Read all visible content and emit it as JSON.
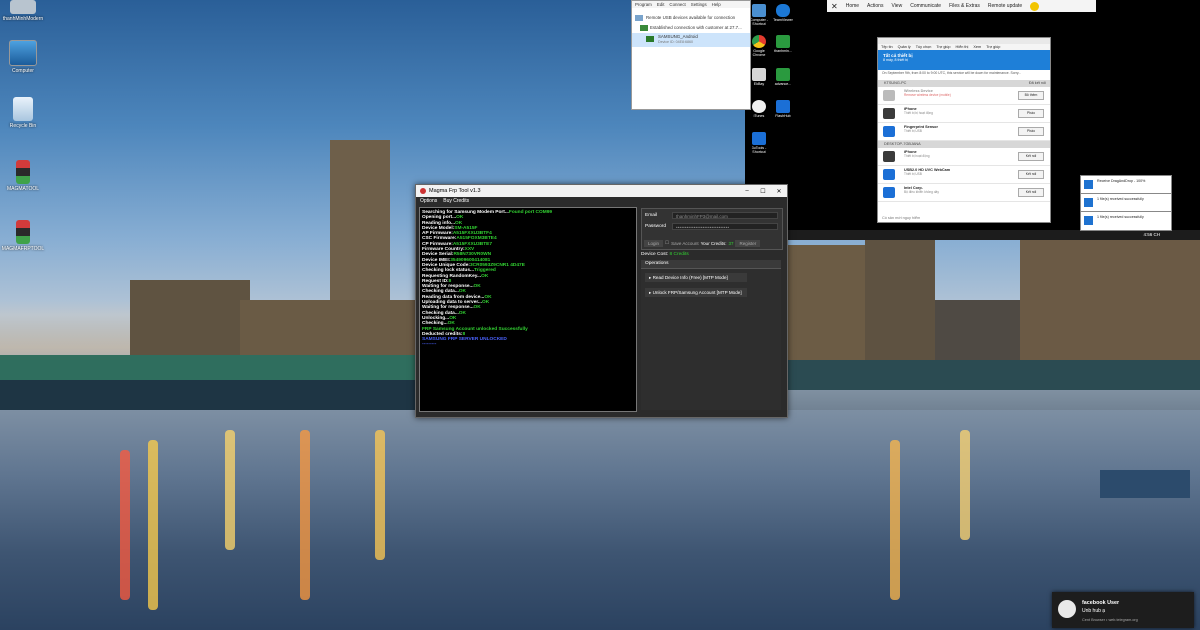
{
  "desktop": {
    "icons": [
      {
        "label": "thanhMinhModern"
      },
      {
        "label": "Computer"
      },
      {
        "label": "Recycle Bin"
      },
      {
        "label": "MAGMATOOL"
      },
      {
        "label": "MAGMAFRPTOOL"
      }
    ]
  },
  "magma": {
    "title": "Magma Frp Tool v1.3",
    "menu": [
      "Options",
      "Buy Credits"
    ],
    "log": [
      {
        "label": "Searching for Samsung Modem Port...",
        "value": "Found port COM99"
      },
      {
        "label": "Opening port...",
        "value": "OK"
      },
      {
        "label": "Reading info...",
        "value": "OK"
      },
      {
        "label": "Device Model:",
        "value": "SM-A515F"
      },
      {
        "label": "AP Firmware:",
        "value": "A515FXXU3BTF4"
      },
      {
        "label": "CSC Firmware:",
        "value": "A515FOXM3BTE4"
      },
      {
        "label": "CP Firmware:",
        "value": "A515FXXU3BTE7"
      },
      {
        "label": "Firmware Country:",
        "value": "XXV"
      },
      {
        "label": "Device Serial:",
        "value": "R58N730VR0WN"
      },
      {
        "label": "Device IMEI:",
        "value": "354909600414081"
      },
      {
        "label": "Device Unique Code:",
        "value": "3CR0593Z9CNR1 4D47E"
      },
      {
        "label": "Checking lock status...",
        "value": "Triggered"
      },
      {
        "label": "Requesting RandomKey...",
        "value": "OK"
      },
      {
        "label": "Request ID:",
        "value": "8"
      },
      {
        "label": "Waiting for response...",
        "value": "OK"
      },
      {
        "label": "Checking data...",
        "value": "OK"
      },
      {
        "label": "Reading data from device...",
        "value": "OK"
      },
      {
        "label": "Uploading data to server...",
        "value": "OK"
      },
      {
        "label": "Waiting for response...",
        "value": "OK"
      },
      {
        "label": "Checking data...",
        "value": "OK"
      },
      {
        "label": "Unlocking...",
        "value": "OK"
      },
      {
        "label": "Checking...",
        "value": "OK"
      },
      {
        "label": "",
        "value": "FRP Samsung Account unlocked Successfully"
      },
      {
        "label": "Deducted credits:",
        "value": "8"
      },
      {
        "label": "",
        "value": "SAMSUNG FRP SERVER UNLOCKED",
        "blue": true
      },
      {
        "label": "",
        "value": "---------",
        "blue": true
      }
    ],
    "login": {
      "email_label": "Email",
      "email_value": "thanhminhFP3@mail.com",
      "password_label": "Password",
      "password_value": "••••••••••••••••••••••••••••••",
      "login_btn": "Login",
      "save_btn": "Save Account",
      "credits_label": "Your Credits:",
      "credits_value": "37",
      "register_btn": "Register"
    },
    "device_cost_label": "Device Cost:",
    "device_cost_value": "8 Credits",
    "operations_header": "Operations",
    "operations": [
      "Read Device Info (Free) [MTP Mode]",
      "Unlock FRP/Samsung Account [MTP Mode]"
    ]
  },
  "usb": {
    "menu": [
      "Program",
      "Edit",
      "Connect",
      "Settings",
      "Help"
    ],
    "rows": [
      "Remote USB devices available for connection",
      "Established connection with customer at 27.7...",
      "SAMSUNG_Android"
    ],
    "sub": "Device ID: 04E8:6860"
  },
  "remote_toolbar": {
    "items": [
      "Home",
      "Actions",
      "View",
      "Communicate",
      "Files & Extras",
      "Remote update"
    ]
  },
  "remote_icons": [
    {
      "label": "Computer - Shortcut"
    },
    {
      "label": "TeamViewer"
    },
    {
      "label": "Google Chrome"
    },
    {
      "label": "thanhmin..."
    },
    {
      "label": "EkBay"
    },
    {
      "label": "advance..."
    },
    {
      "label": "iTunes"
    },
    {
      "label": "FlashHub"
    },
    {
      "label": "3uTools - Shortcut"
    }
  ],
  "rwin": {
    "menu": [
      "Tệp tin",
      "Quản lý",
      "Tùy chọn",
      "Trợ giúp",
      "Hiển thị",
      "Xem",
      "Trợ giúp"
    ],
    "banner_title": "Tất cả thiết bị",
    "banner_sub": "8 máy, 8 thiết bị",
    "notice": "On September 9th, from 8:00 to 9:00 UTC, this service will be down for maintenance. Sorry...",
    "group1": "KTSUNG-PC",
    "group1_status": "Đã kết nối",
    "devices1": [
      {
        "name": "Wireless Device",
        "sub": "Remove wireless device (mobile)",
        "action": "Bỏ thêm"
      },
      {
        "name": "iPhone",
        "sub": "Thiết bị bị hoạt động",
        "action": "Pháo"
      },
      {
        "name": "Fingerprint Sensor",
        "sub": "Thiết bị USB",
        "action": "Pháo"
      }
    ],
    "group2": "DESKTOP-7GBJANA",
    "devices2": [
      {
        "name": "iPhone",
        "sub": "Thiết bị hoạt động",
        "action": "Kết nối"
      },
      {
        "name": "USB2.0 HD UVC WebCam",
        "sub": "Thiết bị USB",
        "action": "Kết nối"
      },
      {
        "name": "Intel Corp.",
        "sub": "Bộ điều khiển không dây",
        "action": "Kết nối"
      }
    ],
    "footer": "Có sản mới nguy hiểm"
  },
  "remote_taskbar": {
    "clock": "4:56 CH"
  },
  "toasts": [
    {
      "text": "Receive DragAndDrop - 100%"
    },
    {
      "text": "1 file(s) received successfully"
    },
    {
      "text": "1 file(s) received successfully"
    }
  ],
  "notification": {
    "title": "facebook User",
    "message": "Unb hub ạ",
    "source": "Cent Browser • web.telegram.org"
  }
}
